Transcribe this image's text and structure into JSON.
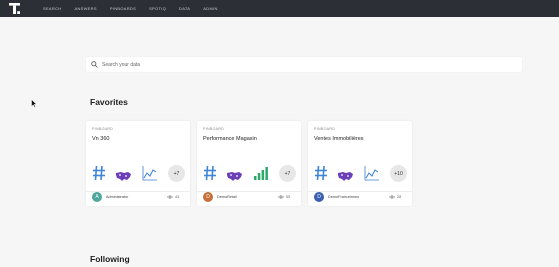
{
  "header": {
    "logo": "T-logo",
    "nav": [
      "Search",
      "Answers",
      "Pinboards",
      "Spotiq",
      "Data",
      "Admin"
    ]
  },
  "search": {
    "placeholder": "Search your data"
  },
  "favorites": {
    "title": "Favorites",
    "cards": [
      {
        "type": "Pinboard",
        "name": "Vn 360",
        "more": "+7",
        "avatar": "A",
        "avatar_color": "#4fa69d",
        "user": "Administrator",
        "views": "43",
        "trend_color": "#3b7dd8"
      },
      {
        "type": "Pinboard",
        "name": "Performance Magasin",
        "more": "+7",
        "avatar": "D",
        "avatar_color": "#c56f3a",
        "user": "DemoRetail",
        "views": "55",
        "trend_color": "#2ea86b"
      },
      {
        "type": "Pinboard",
        "name": "Ventes Immobilières",
        "more": "+10",
        "avatar": "D",
        "avatar_color": "#3b5fb0",
        "user": "DemoFrancelmmo",
        "views": "28",
        "trend_color": "#3b7dd8"
      }
    ]
  },
  "following": {
    "title": "Following"
  },
  "colors": {
    "topbar": "#2d2f36",
    "hash": "#3f87d6",
    "map": "#6a3fb8"
  }
}
